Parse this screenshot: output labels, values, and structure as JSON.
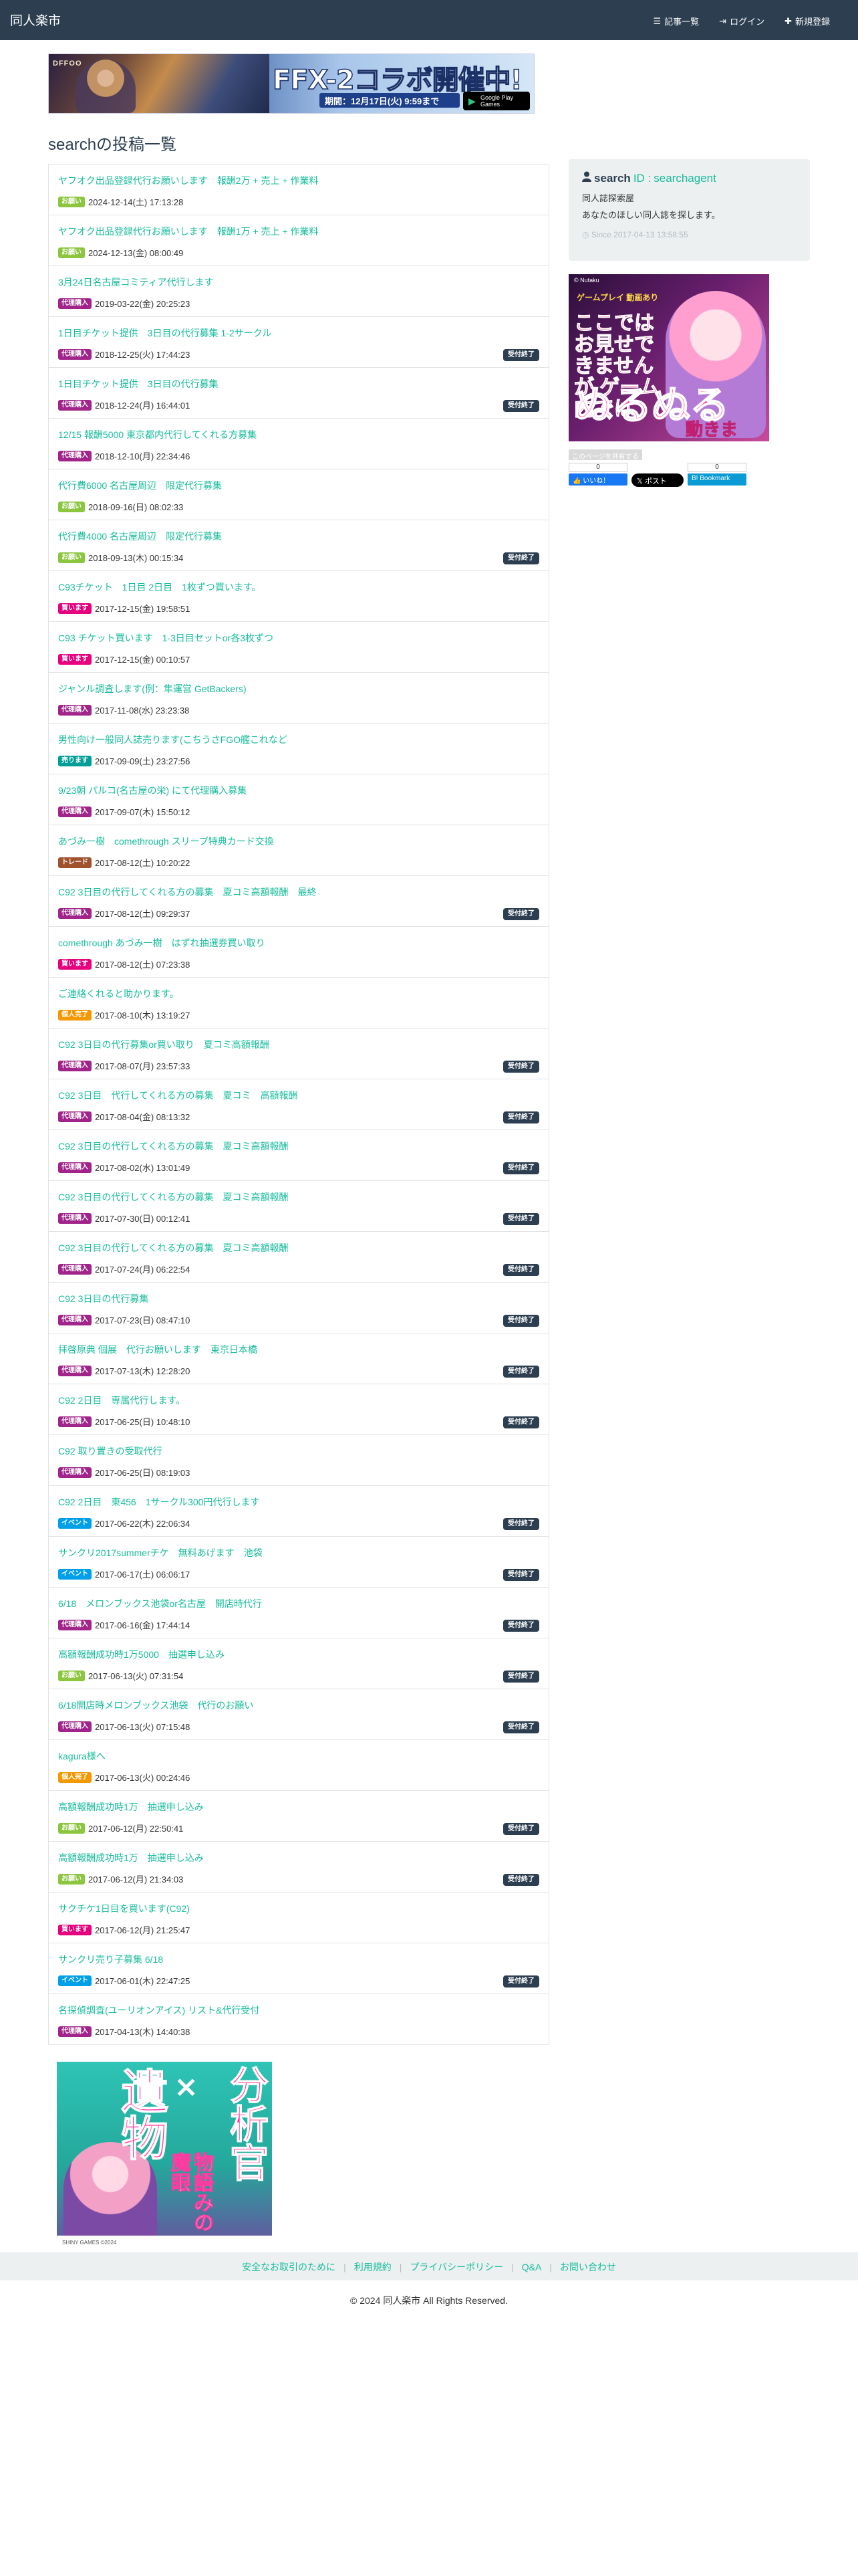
{
  "app": {
    "brand": "同人楽市"
  },
  "nav": {
    "articles": "記事一覧",
    "login": "ログイン",
    "register": "新規登録"
  },
  "banner_top": {
    "logo": "DFFOO",
    "headline": "FFX-2コラボ開催中!",
    "period": "期間：12月17日(火) 9:59まで",
    "store": "Google Play Games"
  },
  "page": {
    "title": "searchの投稿一覧"
  },
  "colors": {
    "accent": "#18bc9c",
    "navbar": "#2c3e50",
    "cat_onegai": "#8cc63f",
    "cat_daiko": "#a0248a",
    "cat_kaimasu": "#e6007e",
    "cat_urimasu": "#009e96",
    "cat_trade": "#a0522d",
    "cat_boshu": "#f39800",
    "cat_event": "#00a0e9"
  },
  "posts": [
    {
      "title": "ヤフオク出品登録代行お願いします　報酬2万 + 売上 + 作業料",
      "category": "お願い",
      "cat_color": "#8cc63f",
      "date": "2024-12-14(土) 17:13:28",
      "status": ""
    },
    {
      "title": "ヤフオク出品登録代行お願いします　報酬1万 + 売上 + 作業料",
      "category": "お願い",
      "cat_color": "#8cc63f",
      "date": "2024-12-13(金) 08:00:49",
      "status": ""
    },
    {
      "title": "3月24日名古屋コミティア代行します",
      "category": "代理購入",
      "cat_color": "#a0248a",
      "date": "2019-03-22(金) 20:25:23",
      "status": ""
    },
    {
      "title": "1日目チケット提供　3日目の代行募集 1-2サークル",
      "category": "代理購入",
      "cat_color": "#a0248a",
      "date": "2018-12-25(火) 17:44:23",
      "status": "受付終了"
    },
    {
      "title": "1日目チケット提供　3日目の代行募集",
      "category": "代理購入",
      "cat_color": "#a0248a",
      "date": "2018-12-24(月) 16:44:01",
      "status": "受付終了"
    },
    {
      "title": "12/15 報酬5000 東京都内代行してくれる方募集",
      "category": "代理購入",
      "cat_color": "#a0248a",
      "date": "2018-12-10(月) 22:34:46",
      "status": ""
    },
    {
      "title": "代行費6000 名古屋周辺　限定代行募集",
      "category": "お願い",
      "cat_color": "#8cc63f",
      "date": "2018-09-16(日) 08:02:33",
      "status": ""
    },
    {
      "title": "代行費4000 名古屋周辺　限定代行募集",
      "category": "お願い",
      "cat_color": "#8cc63f",
      "date": "2018-09-13(木) 00:15:34",
      "status": "受付終了"
    },
    {
      "title": "C93チケット　1日目 2日目　1枚ずつ買います。",
      "category": "買います",
      "cat_color": "#e6007e",
      "date": "2017-12-15(金) 19:58:51",
      "status": ""
    },
    {
      "title": "C93 チケット買います　1-3日目セットor各3枚ずつ",
      "category": "買います",
      "cat_color": "#e6007e",
      "date": "2017-12-15(金) 00:10:57",
      "status": ""
    },
    {
      "title": "ジャンル調査します(例：隼運営 GetBackers)",
      "category": "代理購入",
      "cat_color": "#a0248a",
      "date": "2017-11-08(水) 23:23:38",
      "status": ""
    },
    {
      "title": "男性向け一般同人誌売ります(こちうさFGO艦これなど",
      "category": "売ります",
      "cat_color": "#009e96",
      "date": "2017-09-09(土) 23:27:56",
      "status": ""
    },
    {
      "title": "9/23朝 パルコ(名古屋の栄) にて代理購入募集",
      "category": "代理購入",
      "cat_color": "#a0248a",
      "date": "2017-09-07(木) 15:50:12",
      "status": ""
    },
    {
      "title": "あづみ一樹　comethrough スリーブ特典カード交換",
      "category": "トレード",
      "cat_color": "#a0522d",
      "date": "2017-08-12(土) 10:20:22",
      "status": ""
    },
    {
      "title": "C92 3日目の代行してくれる方の募集　夏コミ高額報酬　最終",
      "category": "代理購入",
      "cat_color": "#a0248a",
      "date": "2017-08-12(土) 09:29:37",
      "status": "受付終了"
    },
    {
      "title": "comethrough あづみ一樹　はずれ抽選券買い取り",
      "category": "買います",
      "cat_color": "#e6007e",
      "date": "2017-08-12(土) 07:23:38",
      "status": ""
    },
    {
      "title": "ご連絡くれると助かります。",
      "category": "個人完了",
      "cat_color": "#f39800",
      "date": "2017-08-10(木) 13:19:27",
      "status": ""
    },
    {
      "title": "C92 3日目の代行募集or買い取り　夏コミ高額報酬",
      "category": "代理購入",
      "cat_color": "#a0248a",
      "date": "2017-08-07(月) 23:57:33",
      "status": "受付終了"
    },
    {
      "title": "C92 3日目　代行してくれる方の募集　夏コミ　高額報酬",
      "category": "代理購入",
      "cat_color": "#a0248a",
      "date": "2017-08-04(金) 08:13:32",
      "status": "受付終了"
    },
    {
      "title": "C92 3日目の代行してくれる方の募集　夏コミ高額報酬",
      "category": "代理購入",
      "cat_color": "#a0248a",
      "date": "2017-08-02(水) 13:01:49",
      "status": "受付終了"
    },
    {
      "title": "C92 3日目の代行してくれる方の募集　夏コミ高額報酬",
      "category": "代理購入",
      "cat_color": "#a0248a",
      "date": "2017-07-30(日) 00:12:41",
      "status": "受付終了"
    },
    {
      "title": "C92 3日目の代行してくれる方の募集　夏コミ高額報酬",
      "category": "代理購入",
      "cat_color": "#a0248a",
      "date": "2017-07-24(月) 06:22:54",
      "status": "受付終了"
    },
    {
      "title": "C92 3日目の代行募集",
      "category": "代理購入",
      "cat_color": "#a0248a",
      "date": "2017-07-23(日) 08:47:10",
      "status": "受付終了"
    },
    {
      "title": "拝啓原典 個展　代行お願いします　東京日本橋",
      "category": "代理購入",
      "cat_color": "#a0248a",
      "date": "2017-07-13(木) 12:28:20",
      "status": "受付終了"
    },
    {
      "title": "C92 2日目　専属代行します。",
      "category": "代理購入",
      "cat_color": "#a0248a",
      "date": "2017-06-25(日) 10:48:10",
      "status": "受付終了"
    },
    {
      "title": "C92 取り置きの受取代行",
      "category": "代理購入",
      "cat_color": "#a0248a",
      "date": "2017-06-25(日) 08:19:03",
      "status": ""
    },
    {
      "title": "C92 2日目　東456　1サークル300円代行します",
      "category": "イベント",
      "cat_color": "#00a0e9",
      "date": "2017-06-22(木) 22:06:34",
      "status": "受付終了"
    },
    {
      "title": "サンクリ2017summerチケ　無料あげます　池袋",
      "category": "イベント",
      "cat_color": "#00a0e9",
      "date": "2017-06-17(土) 06:06:17",
      "status": "受付終了"
    },
    {
      "title": "6/18　メロンブックス池袋or名古屋　開店時代行",
      "category": "代理購入",
      "cat_color": "#a0248a",
      "date": "2017-06-16(金) 17:44:14",
      "status": "受付終了"
    },
    {
      "title": "高額報酬成功時1万5000　抽選申し込み",
      "category": "お願い",
      "cat_color": "#8cc63f",
      "date": "2017-06-13(火) 07:31:54",
      "status": "受付終了"
    },
    {
      "title": "6/18開店時メロンブックス池袋　代行のお願い",
      "category": "代理購入",
      "cat_color": "#a0248a",
      "date": "2017-06-13(火) 07:15:48",
      "status": "受付終了"
    },
    {
      "title": "kagura様へ",
      "category": "個人完了",
      "cat_color": "#f39800",
      "date": "2017-06-13(火) 00:24:46",
      "status": ""
    },
    {
      "title": "高額報酬成功時1万　抽選申し込み",
      "category": "お願い",
      "cat_color": "#8cc63f",
      "date": "2017-06-12(月) 22:50:41",
      "status": "受付終了"
    },
    {
      "title": "高額報酬成功時1万　抽選申し込み",
      "category": "お願い",
      "cat_color": "#8cc63f",
      "date": "2017-06-12(月) 21:34:03",
      "status": "受付終了"
    },
    {
      "title": "サクチケ1日目を買います(C92)",
      "category": "買います",
      "cat_color": "#e6007e",
      "date": "2017-06-12(月) 21:25:47",
      "status": ""
    },
    {
      "title": "サンクリ売り子募集 6/18",
      "category": "イベント",
      "cat_color": "#00a0e9",
      "date": "2017-06-01(木) 22:47:25",
      "status": "受付終了"
    },
    {
      "title": "名探偵調査(ユーリオンアイス) リスト&代行受付",
      "category": "代理購入",
      "cat_color": "#a0248a",
      "date": "2017-04-13(木) 14:40:38",
      "status": ""
    }
  ],
  "sidebar": {
    "name": "search",
    "id_prefix": "ID :",
    "id": "searchagent",
    "line1": "同人誌探索屋",
    "line2": "あなたのほしい同人誌を探します。",
    "since_prefix": "Since",
    "since": "2017-04-13 13:58:55"
  },
  "sidebar_ad": {
    "t1": "© Nutaku",
    "t2": "ゲームプレイ 動画あり",
    "t3": "ここでは お見せできませんが ゲーム内では",
    "t4": "ぬるぬる",
    "t5": "動きます。"
  },
  "share": {
    "label": "このページを共有する",
    "fb_count": "0",
    "fb_label": "いいね！",
    "x_label": "ポスト",
    "bm_count": "0",
    "bm_label": "Bookmark"
  },
  "banner_bottom": {
    "c1": "遺物",
    "c2": "×",
    "c3": "分析官",
    "c4": "物語みの魔眼",
    "foot": "SHINY GAMES ©2024 "
  },
  "footer": {
    "links": [
      "安全なお取引のために",
      "利用規約",
      "プライバシーポリシー",
      "Q&A",
      "お問い合わせ"
    ],
    "copyright": "© 2024 同人楽市 All Rights Reserved."
  }
}
